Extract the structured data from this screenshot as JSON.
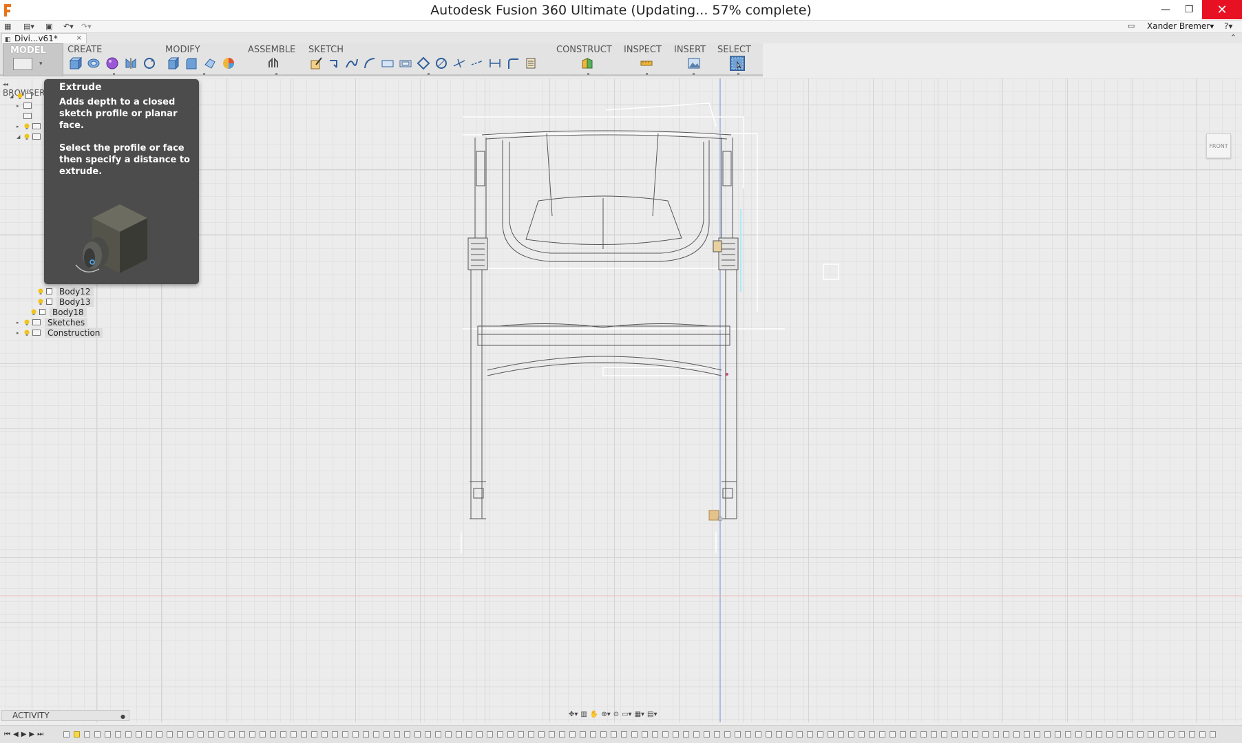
{
  "window": {
    "title": "Autodesk Fusion 360 Ultimate  (Updating... 57% complete)",
    "minimize": "—",
    "maximize": "❐",
    "close": "✕"
  },
  "quick_access": {
    "user": "Xander Bremer▾",
    "help": "?▾",
    "icons": [
      "grid-icon",
      "file-icon",
      "save-icon",
      "undo-icon",
      "redo-icon"
    ]
  },
  "document": {
    "tab_name": "Divi...v61*",
    "close": "×"
  },
  "toolbar": {
    "workspace": "MODEL",
    "groups": [
      {
        "label": "CREATE"
      },
      {
        "label": "MODIFY"
      },
      {
        "label": "ASSEMBLE"
      },
      {
        "label": "SKETCH"
      },
      {
        "label": "CONSTRUCT"
      },
      {
        "label": "INSPECT"
      },
      {
        "label": "INSERT"
      },
      {
        "label": "SELECT"
      }
    ]
  },
  "browser": {
    "header": "BROWSER",
    "items": [
      {
        "label": "Body12"
      },
      {
        "label": "Body13"
      },
      {
        "label": "Body18"
      },
      {
        "label": "Sketches"
      },
      {
        "label": "Construction"
      }
    ]
  },
  "tooltip": {
    "title": "Extrude",
    "line1": "Adds depth to a closed sketch profile or planar face.",
    "line2": "Select the profile or face then specify a distance to extrude."
  },
  "viewcube": {
    "label": "FRONT"
  },
  "activity": {
    "label": "ACTIVITY"
  },
  "colors": {
    "bulb": "#f0c419",
    "close_button": "#e81123",
    "timeline_highlight": "#f7d84a"
  }
}
